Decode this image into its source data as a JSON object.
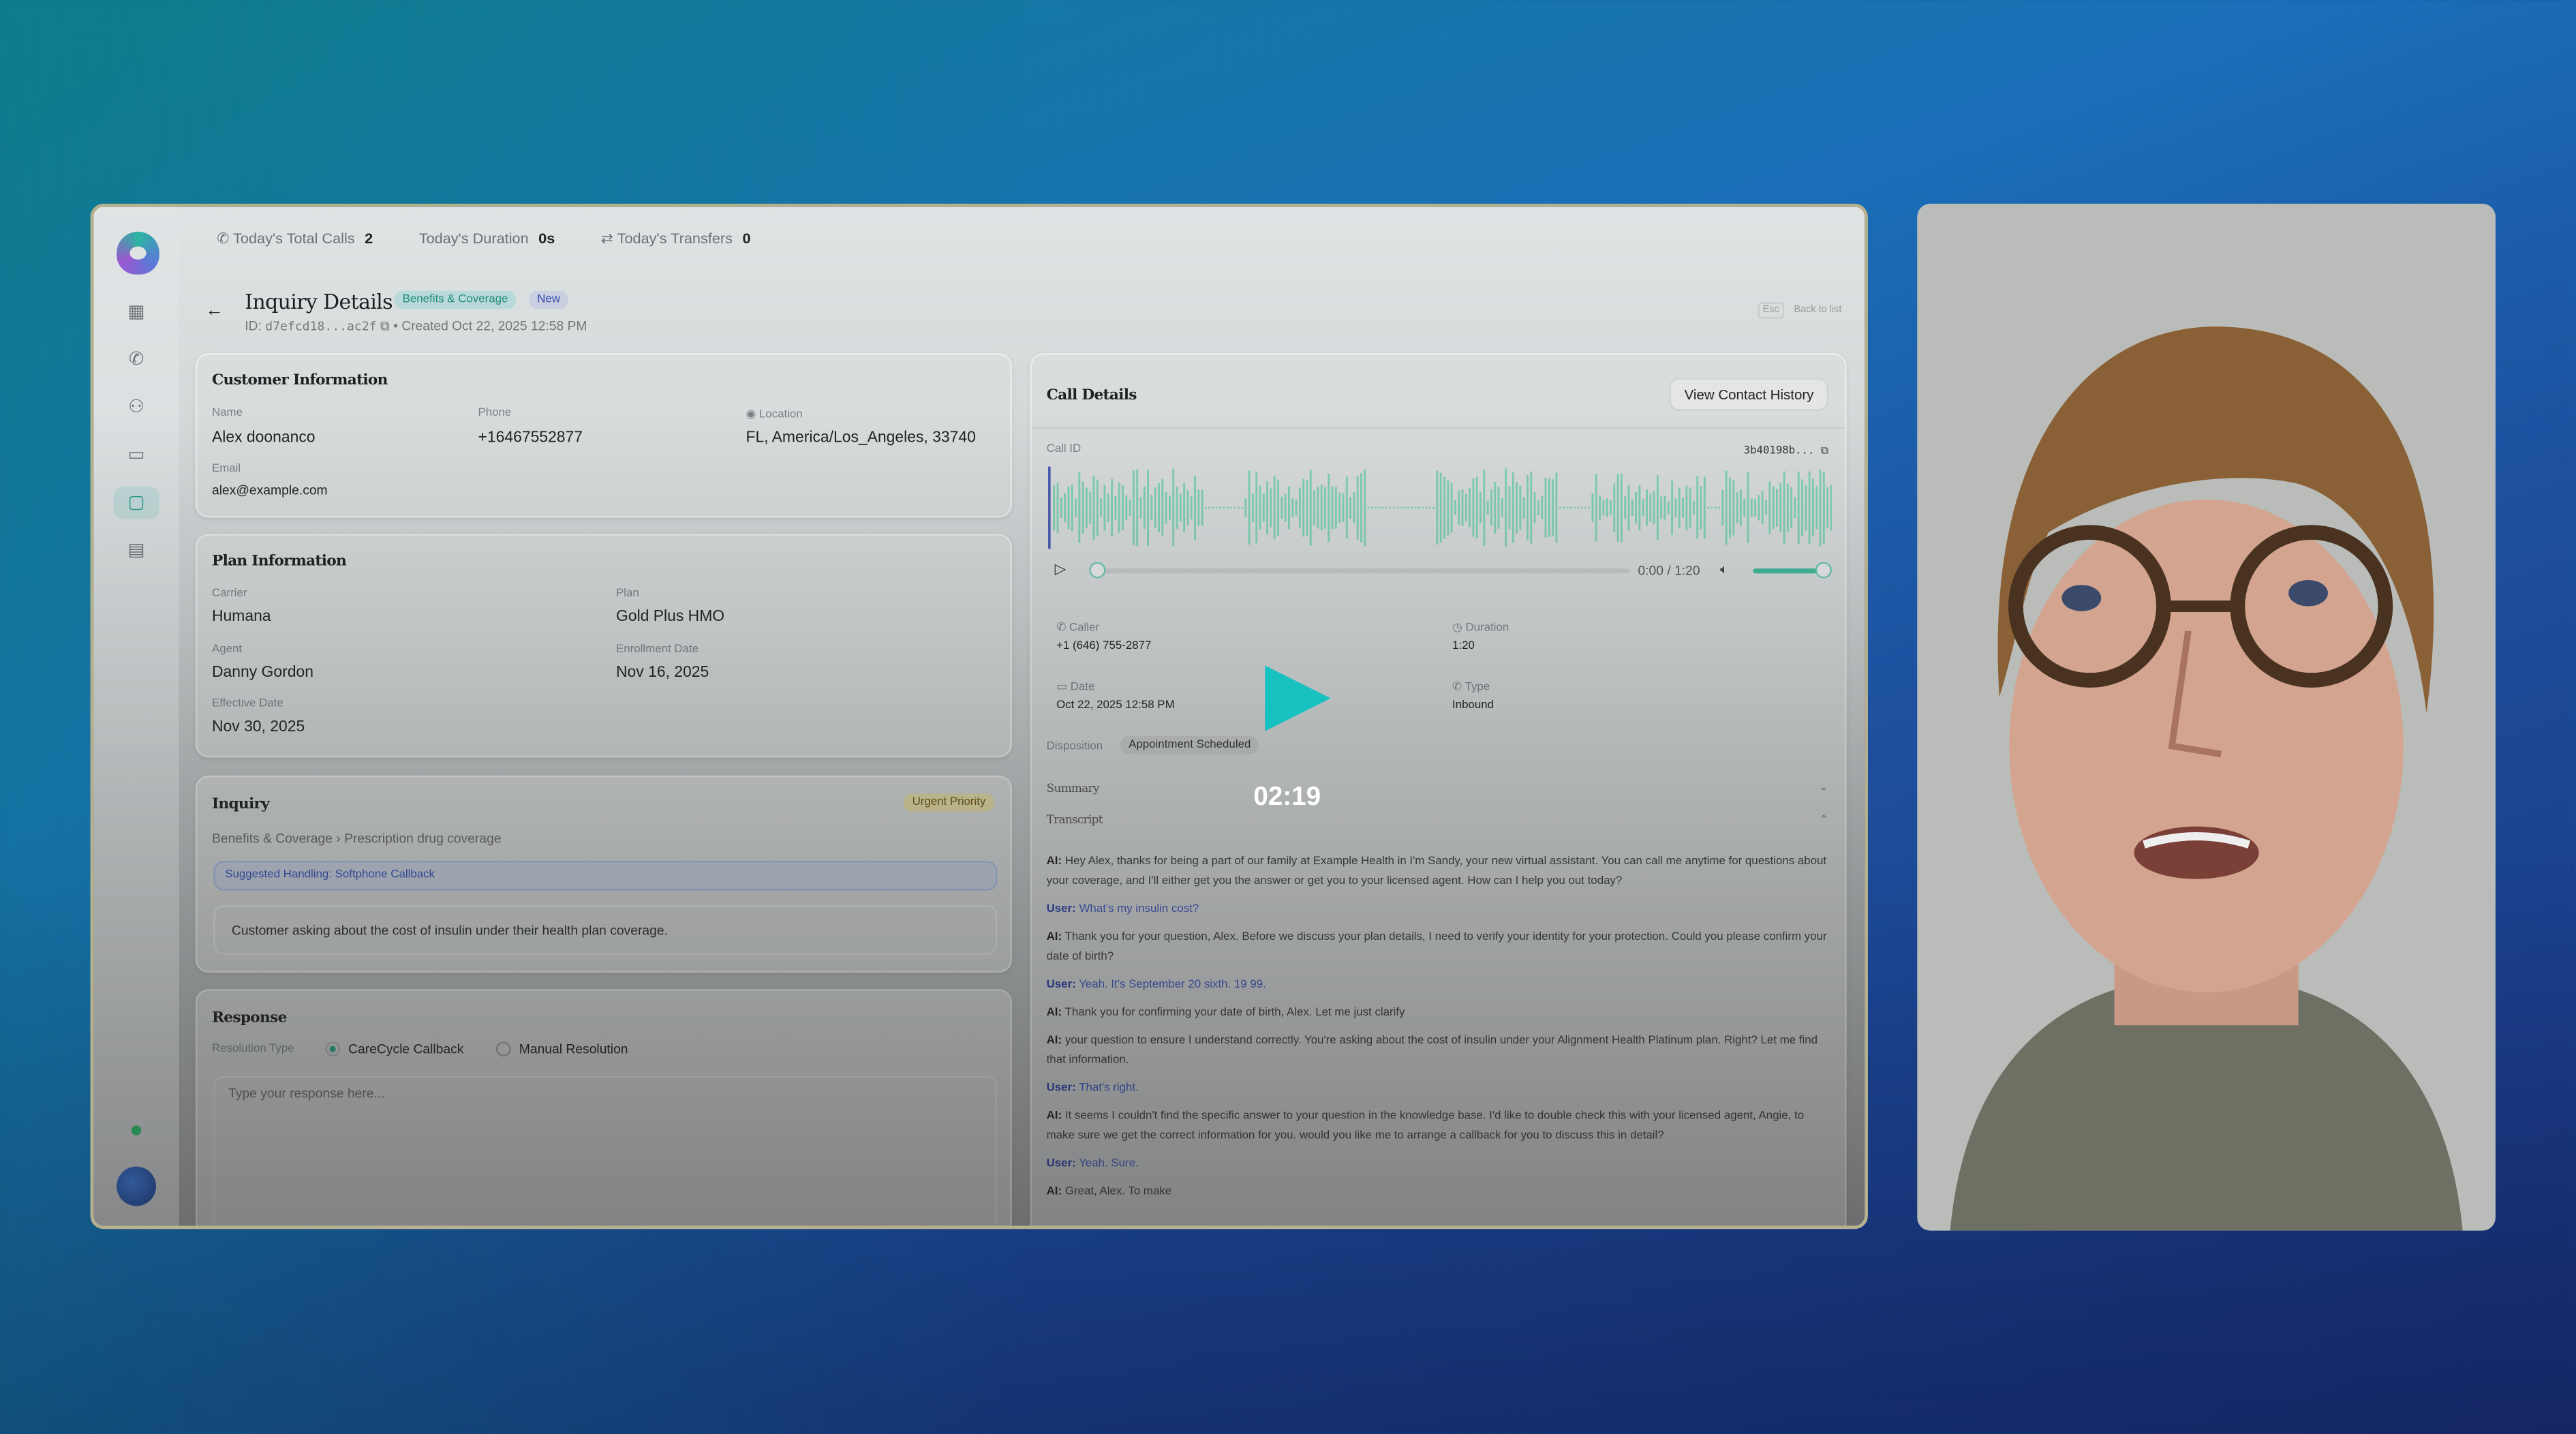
{
  "topbar": {
    "stats": [
      {
        "label": "Today's Total Calls",
        "value": "2",
        "icon": "phone-icon"
      },
      {
        "label": "Today's Duration",
        "value": "0s"
      },
      {
        "label": "Today's Transfers",
        "value": "0",
        "icon": "transfer-icon"
      }
    ]
  },
  "header": {
    "title": "Inquiry Details",
    "badge_category": "Benefits & Coverage",
    "badge_status": "New",
    "id_label": "ID:",
    "id_value": "d7efcd18...ac2f",
    "created": "Created Oct 22, 2025 12:58 PM",
    "esc_key": "Esc",
    "back_to_list": "Back to list"
  },
  "customer": {
    "title": "Customer Information",
    "name_label": "Name",
    "name": "Alex doonanco",
    "phone_label": "Phone",
    "phone": "+16467552877",
    "location_label": "Location",
    "location": "FL, America/Los_Angeles, 33740",
    "email_label": "Email",
    "email": "alex@example.com"
  },
  "plan": {
    "title": "Plan Information",
    "carrier_label": "Carrier",
    "carrier": "Humana",
    "plan_label": "Plan",
    "plan": "Gold Plus HMO",
    "agent_label": "Agent",
    "agent": "Danny Gordon",
    "enroll_label": "Enrollment Date",
    "enroll": "Nov 16, 2025",
    "effective_label": "Effective Date",
    "effective": "Nov 30, 2025"
  },
  "inquiry": {
    "title": "Inquiry",
    "priority": "Urgent Priority",
    "category": "Benefits & Coverage",
    "sep": "›",
    "subcategory": "Prescription drug coverage",
    "suggested": "Suggested Handling: Softphone Callback",
    "description": "Customer asking about the cost of insulin under their health plan coverage."
  },
  "response": {
    "title": "Response",
    "resolution_label": "Resolution Type",
    "option1": "CareCycle Callback",
    "option2": "Manual Resolution",
    "placeholder": "Type your response here..."
  },
  "call": {
    "title": "Call Details",
    "contact_history": "View Contact History",
    "call_id_label": "Call ID",
    "call_id": "3b40198b...",
    "time": "0:00 / 1:20",
    "progress": 0,
    "volume": 1.0,
    "caller_label": "Caller",
    "caller": "+1 (646) 755-2877",
    "duration_label": "Duration",
    "duration": "1:20",
    "date_label": "Date",
    "date": "Oct 22, 2025 12:58 PM",
    "type_label": "Type",
    "type": "Inbound",
    "disposition_label": "Disposition",
    "disposition": "Appointment Scheduled",
    "summary_label": "Summary",
    "transcript_label": "Transcript",
    "transcript": [
      {
        "speaker": "AI:",
        "text": "Hey Alex, thanks for being a part of our family at Example Health in I'm Sandy, your new virtual assistant. You can call me anytime for questions about your coverage, and I'll either get you the answer or get you to your licensed agent. How can I help you out today?"
      },
      {
        "speaker": "User:",
        "text": "What's my insulin cost?"
      },
      {
        "speaker": "AI:",
        "text": "Thank you for your question, Alex. Before we discuss your plan details, I need to verify your identity for your protection. Could you please confirm your date of birth?"
      },
      {
        "speaker": "User:",
        "text": "Yeah. It's September 20 sixth. 19 99."
      },
      {
        "speaker": "AI:",
        "text": "Thank you for confirming your date of birth, Alex. Let me just clarify"
      },
      {
        "speaker": "AI:",
        "text": "your question to ensure I understand correctly. You're asking about the cost of insulin under your Alignment Health Platinum plan. Right? Let me find that information."
      },
      {
        "speaker": "User:",
        "text": "That's right."
      },
      {
        "speaker": "AI:",
        "text": "It seems I couldn't find the specific answer to your question in the knowledge base. I'd like to double check this with your licensed agent, Angie, to make sure we get the correct information for you. would you like me to arrange a callback for you to discuss this in detail?"
      },
      {
        "speaker": "User:",
        "text": "Yeah. Sure."
      },
      {
        "speaker": "AI:",
        "text": "Great, Alex. To make"
      }
    ]
  },
  "video": {
    "timer": "02:19"
  },
  "colors": {
    "accent": "#17c1c0",
    "wave": "#7fcfb2",
    "user": "#3d55b5"
  }
}
